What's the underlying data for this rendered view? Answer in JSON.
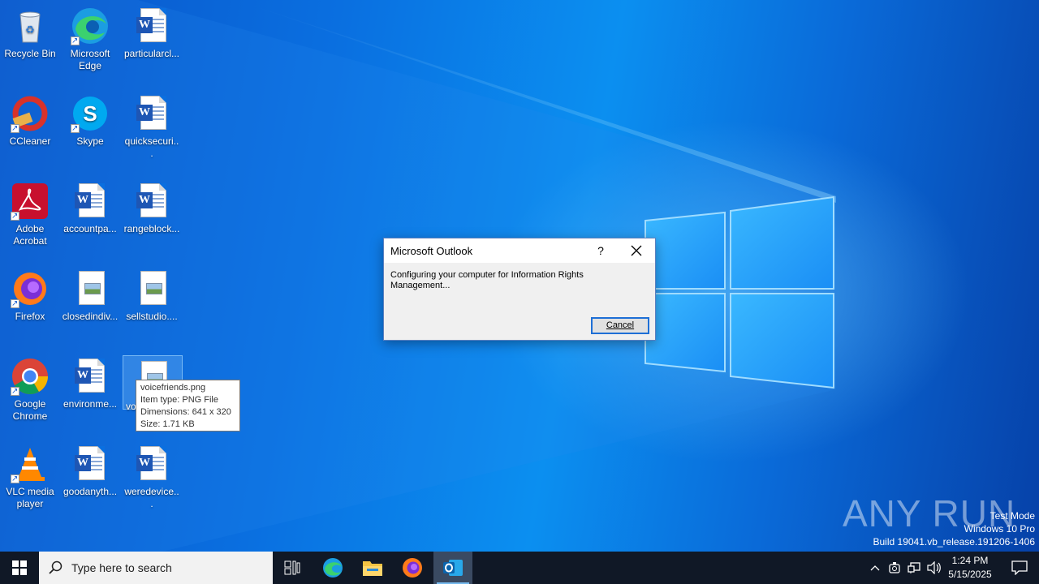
{
  "desktop": {
    "icons": [
      {
        "label": "Recycle Bin",
        "icon": "recycle-bin-icon"
      },
      {
        "label": "Microsoft Edge",
        "icon": "edge-icon"
      },
      {
        "label": "particularcl...",
        "icon": "word-doc-icon"
      },
      {
        "label": "CCleaner",
        "icon": "ccleaner-icon"
      },
      {
        "label": "Skype",
        "icon": "skype-icon"
      },
      {
        "label": "quicksecuri...",
        "icon": "word-doc-icon"
      },
      {
        "label": "Adobe Acrobat",
        "icon": "acrobat-icon"
      },
      {
        "label": "accountpa...",
        "icon": "word-doc-icon"
      },
      {
        "label": "rangeblock...",
        "icon": "word-doc-icon"
      },
      {
        "label": "Firefox",
        "icon": "firefox-icon"
      },
      {
        "label": "closedindiv...",
        "icon": "image-file-icon"
      },
      {
        "label": "sellstudio....",
        "icon": "image-file-icon"
      },
      {
        "label": "Google Chrome",
        "icon": "chrome-icon"
      },
      {
        "label": "environme...",
        "icon": "word-doc-icon"
      },
      {
        "label": "vo",
        "icon": "image-file-icon"
      },
      {
        "label": "VLC media player",
        "icon": "vlc-icon"
      },
      {
        "label": "goodanyth...",
        "icon": "word-doc-icon"
      },
      {
        "label": "weredevice...",
        "icon": "word-doc-icon"
      }
    ]
  },
  "tooltip": {
    "name": "voicefriends.png",
    "type": "Item type: PNG File",
    "dimensions": "Dimensions: 641 x 320",
    "size": "Size: 1.71 KB"
  },
  "dialog": {
    "title": "Microsoft Outlook",
    "help": "?",
    "message": "Configuring your computer for Information Rights Management...",
    "cancel_label": "Cancel"
  },
  "watermark": {
    "brand": "ANY RUN",
    "line1": "Test Mode",
    "line2": "Windows 10 Pro",
    "line3": "Build 19041.vb_release.191206-1406"
  },
  "taskbar": {
    "search_placeholder": "Type here to search",
    "time": "1:24 PM",
    "date": "5/15/2025",
    "apps": [
      "start-icon",
      "task-view-icon",
      "edge-icon",
      "file-explorer-icon",
      "firefox-icon",
      "outlook-icon"
    ]
  },
  "colors": {
    "taskbar": "#101826",
    "accent": "#1e6fd6",
    "wallpaper": "#0a6fe0"
  }
}
